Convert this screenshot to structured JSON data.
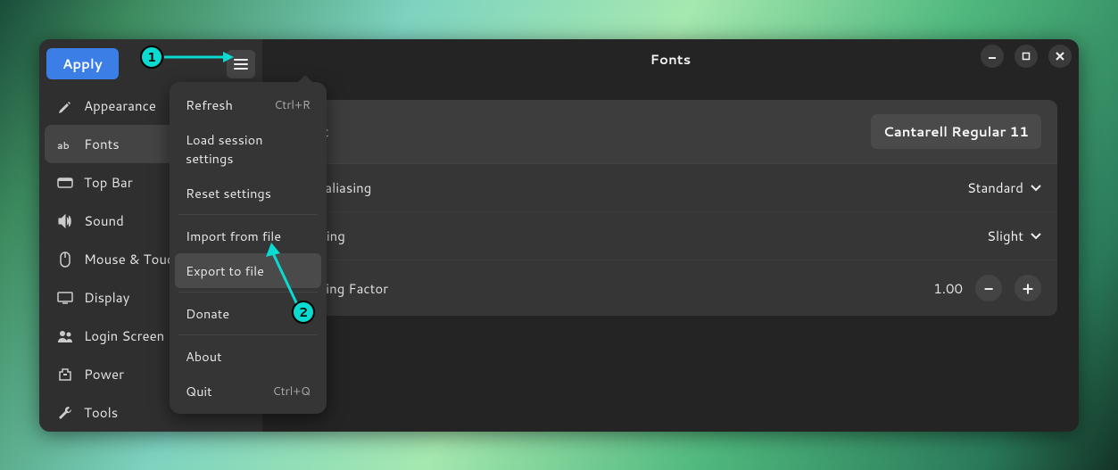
{
  "header": {
    "apply_label": "Apply",
    "title": "Fonts"
  },
  "sidebar": {
    "items": [
      {
        "label": "Appearance"
      },
      {
        "label": "Fonts"
      },
      {
        "label": "Top Bar"
      },
      {
        "label": "Sound"
      },
      {
        "label": "Mouse & Touchpad"
      },
      {
        "label": "Display"
      },
      {
        "label": "Login Screen"
      },
      {
        "label": "Power"
      },
      {
        "label": "Tools"
      }
    ],
    "active_index": 1
  },
  "menu": {
    "items": [
      {
        "label": "Refresh",
        "shortcut": "Ctrl+R"
      },
      {
        "label": "Load session settings"
      },
      {
        "label": "Reset settings"
      },
      {
        "sep": true
      },
      {
        "label": "Import from file"
      },
      {
        "label": "Export to file"
      },
      {
        "sep": true
      },
      {
        "label": "Donate"
      },
      {
        "sep": true
      },
      {
        "label": "About"
      },
      {
        "label": "Quit",
        "shortcut": "Ctrl+Q"
      }
    ],
    "hover_label": "Export to file"
  },
  "settings": {
    "font_label": "Font",
    "font_value": "Cantarell Regular  11",
    "antialiasing_label": "Antialiasing",
    "antialiasing_value": "Standard",
    "hinting_label": "Hinting",
    "hinting_value": "Slight",
    "scaling_label": "Scaling Factor",
    "scaling_value": "1.00"
  },
  "annotations": {
    "badge1": "1",
    "badge2": "2"
  }
}
